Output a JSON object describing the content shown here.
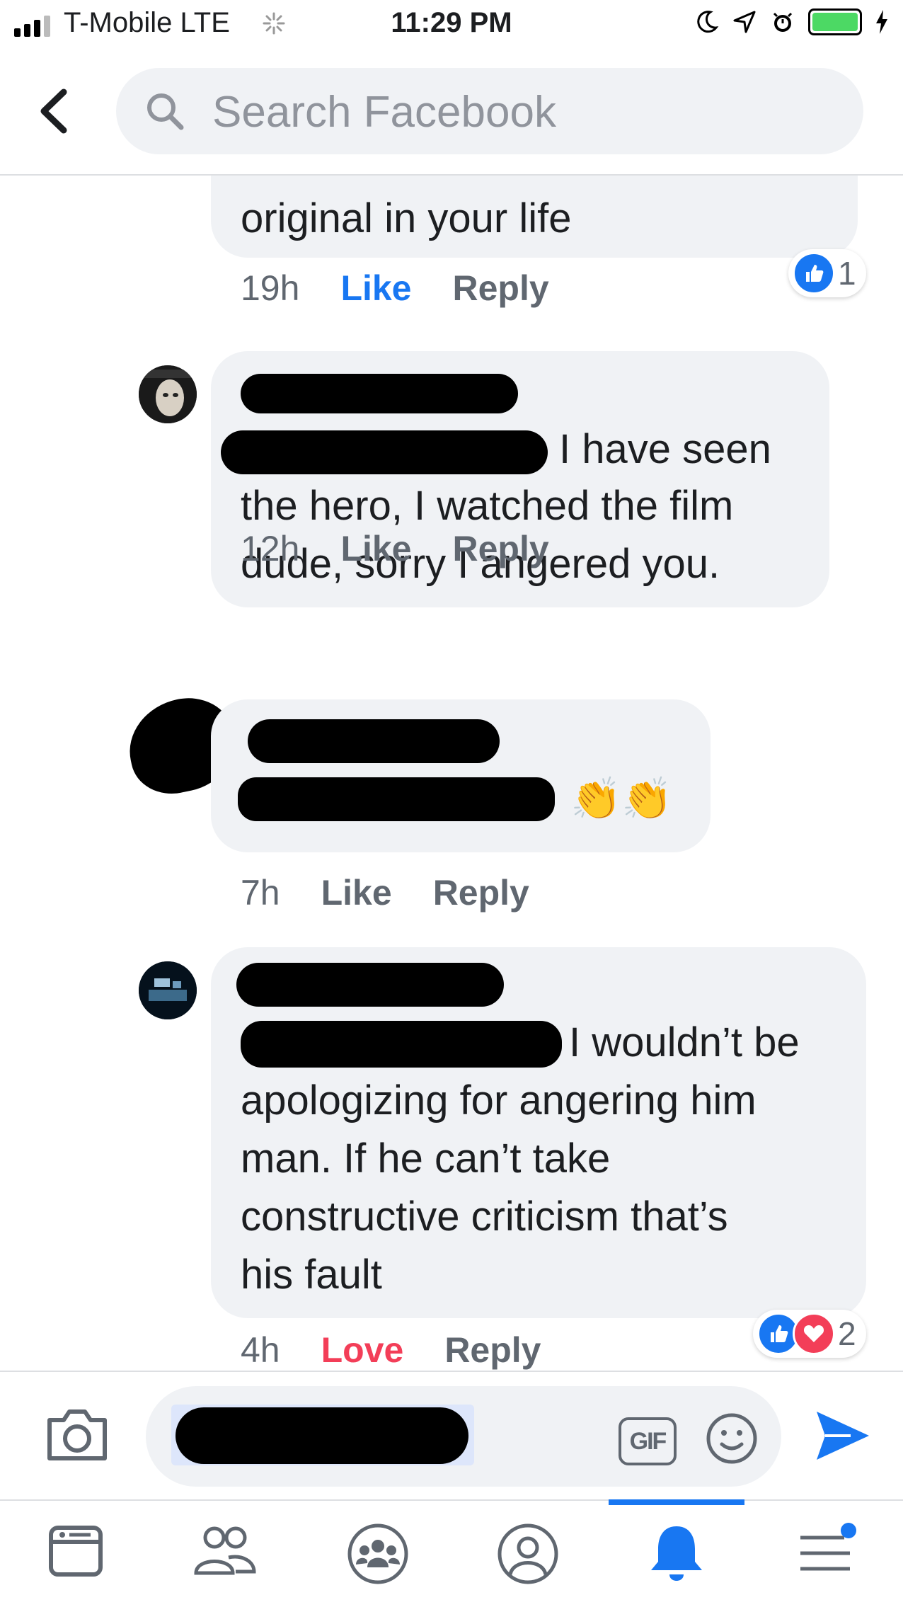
{
  "status_bar": {
    "carrier": "T-Mobile  LTE",
    "time": "11:29 PM"
  },
  "search": {
    "placeholder": "Search Facebook"
  },
  "comments": [
    {
      "text": "original in your life",
      "time": "19h",
      "like_label": "Like",
      "liked": true,
      "reply_label": "Reply",
      "reaction_count": "1"
    },
    {
      "text_line1": "I have seen",
      "text_rest": "the hero, I watched the film\ndude, sorry I angered you.",
      "time": "12h",
      "like_label": "Like",
      "reply_label": "Reply"
    },
    {
      "emoji": "👏👏",
      "time": "7h",
      "like_label": "Like",
      "reply_label": "Reply"
    },
    {
      "text_line1": "I wouldn’t be",
      "text_rest": "apologizing for angering him\nman. If he can’t take\nconstructive criticism that’s\nhis fault",
      "time": "4h",
      "like_label": "Love",
      "reply_label": "Reply",
      "reaction_count": "2"
    }
  ],
  "composer": {
    "gif_label": "GIF"
  },
  "colors": {
    "brand_blue": "#1877f2",
    "love_red": "#f33e58",
    "bubble_gray": "#f0f2f5",
    "meta_gray": "#606770"
  },
  "tabs": [
    "news-feed",
    "friends",
    "groups",
    "profile",
    "notifications",
    "menu"
  ],
  "active_tab": "notifications"
}
